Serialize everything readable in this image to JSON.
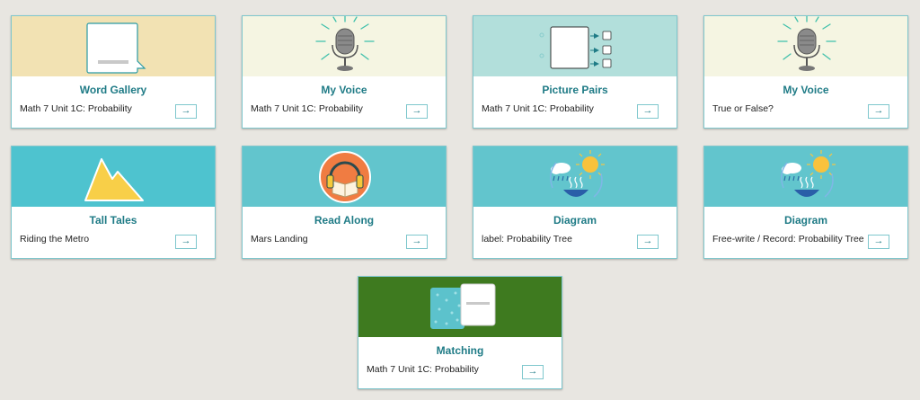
{
  "cards": [
    {
      "title": "Word Gallery",
      "subtitle": "Math 7 Unit 1C: Probability",
      "arrow": "→",
      "icon": "speech-bubble-icon"
    },
    {
      "title": "My Voice",
      "subtitle": "Math 7 Unit 1C: Probability",
      "arrow": "→",
      "icon": "microphone-icon"
    },
    {
      "title": "Picture Pairs",
      "subtitle": "Math 7 Unit 1C: Probability",
      "arrow": "→",
      "icon": "picture-pairs-icon"
    },
    {
      "title": "My Voice",
      "subtitle": "True or False?",
      "arrow": "→",
      "icon": "microphone-icon"
    },
    {
      "title": "Tall Tales",
      "subtitle": "Riding the Metro",
      "arrow": "→",
      "icon": "mountain-icon"
    },
    {
      "title": "Read Along",
      "subtitle": "Mars Landing",
      "arrow": "→",
      "icon": "headphones-book-icon"
    },
    {
      "title": "Diagram",
      "subtitle": "label: Probability Tree",
      "arrow": "→",
      "icon": "water-cycle-icon"
    },
    {
      "title": "Diagram",
      "subtitle": "Free-write / Record: Probability Tree",
      "arrow": "→",
      "icon": "water-cycle-icon"
    },
    {
      "title": "Matching",
      "subtitle": "Math 7 Unit 1C: Probability",
      "arrow": "→",
      "icon": "matching-cards-icon"
    }
  ],
  "colors": {
    "title": "#1f7b86",
    "border": "#7fc7cd",
    "background": "#e8e6e1"
  }
}
